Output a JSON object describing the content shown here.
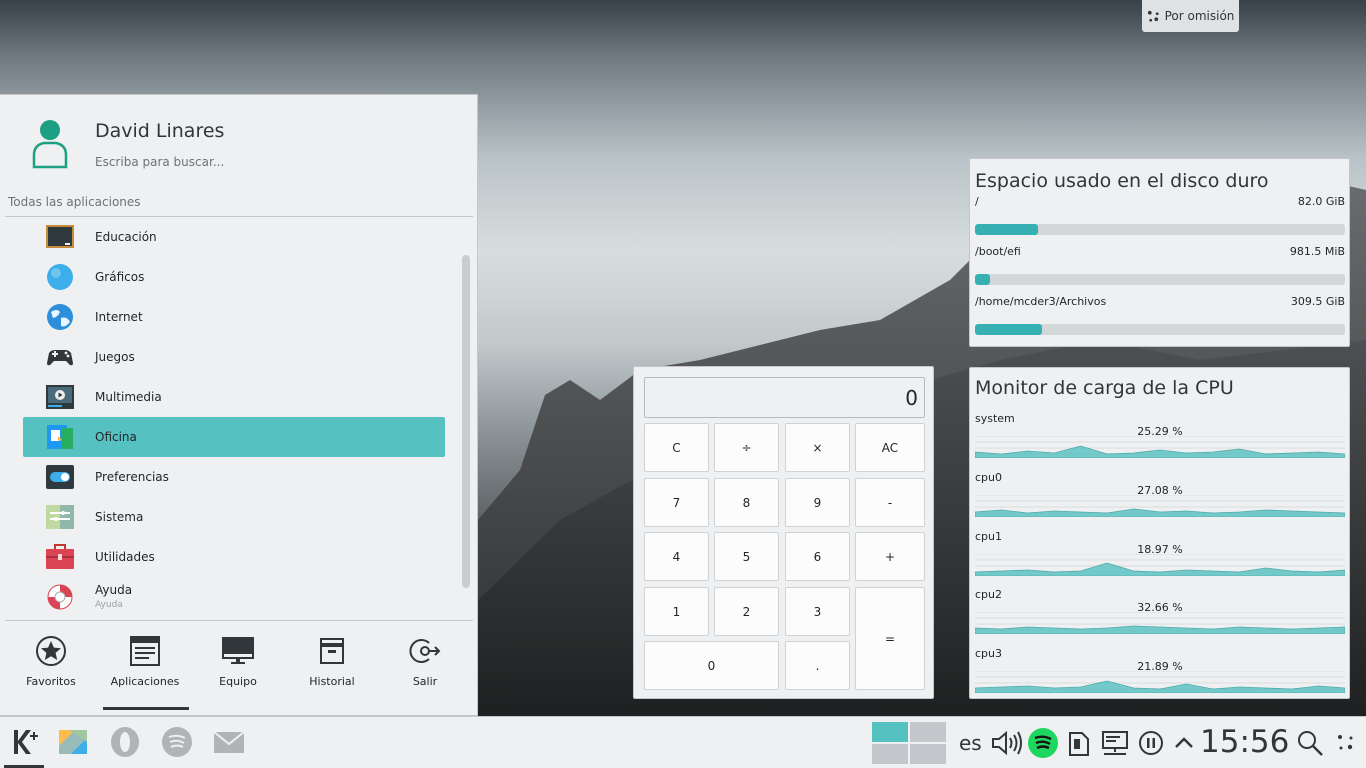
{
  "activity": {
    "label": "Por omisión"
  },
  "menu": {
    "user_name": "David Linares",
    "search_placeholder": "Escriba para buscar...",
    "section_label": "Todas las aplicaciones",
    "apps": [
      {
        "label": "Educación",
        "sub": "",
        "icon": "education-icon"
      },
      {
        "label": "Gráficos",
        "sub": "",
        "icon": "graphics-icon"
      },
      {
        "label": "Internet",
        "sub": "",
        "icon": "internet-icon"
      },
      {
        "label": "Juegos",
        "sub": "",
        "icon": "gamepad-icon"
      },
      {
        "label": "Multimedia",
        "sub": "",
        "icon": "multimedia-icon"
      },
      {
        "label": "Oficina",
        "sub": "",
        "icon": "office-icon"
      },
      {
        "label": "Preferencias",
        "sub": "",
        "icon": "toggle-icon"
      },
      {
        "label": "Sistema",
        "sub": "",
        "icon": "system-icon"
      },
      {
        "label": "Utilidades",
        "sub": "",
        "icon": "toolbox-icon"
      },
      {
        "label": "Ayuda",
        "sub": "Ayuda",
        "icon": "lifebuoy-icon"
      }
    ],
    "active_index": 5,
    "tabs": [
      {
        "label": "Favoritos",
        "icon": "star-icon"
      },
      {
        "label": "Aplicaciones",
        "icon": "applications-icon"
      },
      {
        "label": "Equipo",
        "icon": "monitor-icon"
      },
      {
        "label": "Historial",
        "icon": "history-icon"
      },
      {
        "label": "Salir",
        "icon": "logout-icon"
      }
    ],
    "active_tab": 1
  },
  "calculator": {
    "display": "0",
    "keys": [
      "C",
      "÷",
      "×",
      "AC",
      "7",
      "8",
      "9",
      "-",
      "4",
      "5",
      "6",
      "+",
      "1",
      "2",
      "3",
      "=",
      "0",
      "."
    ]
  },
  "disk_widget": {
    "title": "Espacio usado en el disco duro",
    "disks": [
      {
        "mount": "/",
        "size": "82.0 GiB",
        "used_fraction": 0.17
      },
      {
        "mount": "/boot/efi",
        "size": "981.5 MiB",
        "used_fraction": 0.04
      },
      {
        "mount": "/home/mcder3/Archivos",
        "size": "309.5 GiB",
        "used_fraction": 0.18
      }
    ]
  },
  "cpu_widget": {
    "title": "Monitor de carga de la CPU",
    "cpus": [
      {
        "name": "system",
        "percent": "25.29 %"
      },
      {
        "name": "cpu0",
        "percent": "27.08 %"
      },
      {
        "name": "cpu1",
        "percent": "18.97 %"
      },
      {
        "name": "cpu2",
        "percent": "32.66 %"
      },
      {
        "name": "cpu3",
        "percent": "21.89 %"
      }
    ],
    "graph_color": "#56c1c1"
  },
  "taskbar": {
    "language": "es",
    "clock": "15:56",
    "accent_color": "#56c1c1"
  }
}
